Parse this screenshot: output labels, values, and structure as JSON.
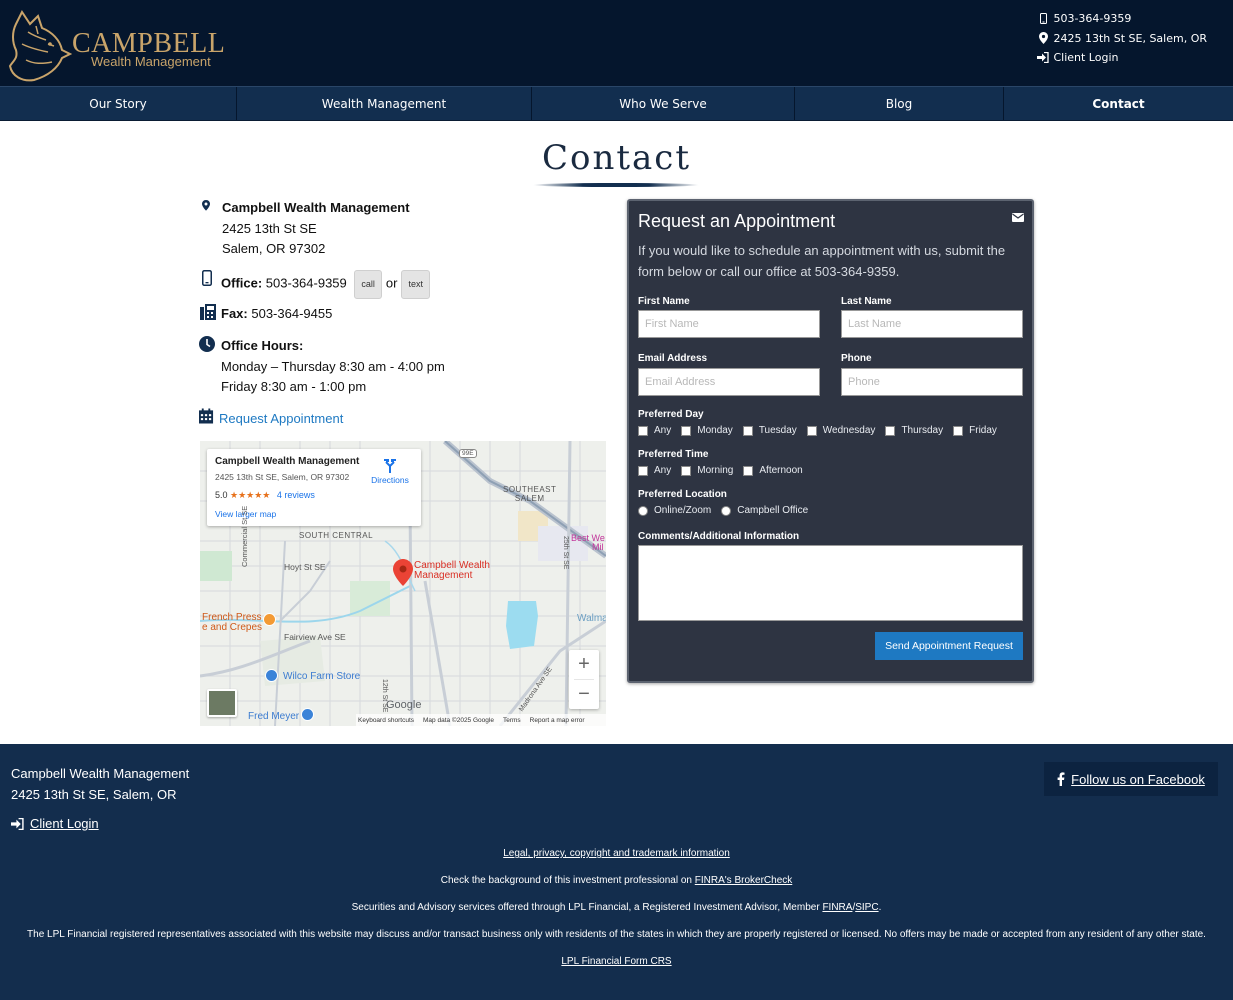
{
  "brand": {
    "name": "CAMPBELL",
    "subtitle": "Wealth Management",
    "logo_icon": "wolf-logo-icon"
  },
  "header": {
    "phone": "503-364-9359",
    "address": "2425 13th St SE, Salem, OR",
    "client_login": "Client Login"
  },
  "nav": {
    "items": [
      {
        "label": "Our Story"
      },
      {
        "label": "Wealth Management"
      },
      {
        "label": "Who We Serve"
      },
      {
        "label": "Blog"
      },
      {
        "label": "Contact",
        "active": true
      }
    ]
  },
  "page": {
    "title": "Contact"
  },
  "info": {
    "company": "Campbell Wealth Management",
    "street": "2425 13th St SE",
    "city": "Salem, OR 97302",
    "office_label": "Office:",
    "office_phone": "503-364-9359",
    "call_label": "call",
    "or_label": "or",
    "text_label": "text",
    "fax_label": "Fax:",
    "fax_number": "503-364-9455",
    "hours_label": "Office Hours:",
    "hours_line1": "Monday – Thursday 8:30 am - 4:00 pm",
    "hours_line2": "Friday 8:30 am - 1:00 pm",
    "request_link": "Request Appointment"
  },
  "map": {
    "card_title": "Campbell Wealth Management",
    "card_address": "2425 13th St SE, Salem, OR 97302",
    "rating": "5.0",
    "stars": "★★★★★",
    "reviews": "4 reviews",
    "larger_map": "View larger map",
    "directions": "Directions",
    "pin_label_1": "Campbell Wealth",
    "pin_label_2": "Management",
    "labels": {
      "southeast_1": "SOUTHEAST",
      "southeast_2": "SALEM",
      "south_central": "SOUTH CENTRAL",
      "hoyt": "Hoyt St SE",
      "commercial": "Commercial St SE",
      "fairview": "Fairview Ave SE",
      "french_1": "French Press",
      "french_2": "e and Crepes",
      "wilco": "Wilco Farm Store",
      "fred": "Fred Meyer",
      "walmart": "Walma",
      "bestwest_1": "Best We",
      "bestwest_2": "Mil",
      "twelfth": "12th St SE",
      "twentyfifth": "25th St SE",
      "madrona": "Madrona Ave SE",
      "highway": "99E",
      "google": "Google"
    },
    "footer_keyboard": "Keyboard shortcuts",
    "footer_data": "Map data ©2025 Google",
    "footer_terms": "Terms",
    "footer_report": "Report a map error"
  },
  "form": {
    "title": "Request an Appointment",
    "intro": "If you would like to schedule an appointment with us, submit the form below or call our office at 503-364-9359.",
    "first_name_label": "First Name",
    "first_name_placeholder": "First Name",
    "last_name_label": "Last Name",
    "last_name_placeholder": "Last Name",
    "email_label": "Email Address",
    "email_placeholder": "Email Address",
    "phone_label": "Phone",
    "phone_placeholder": "Phone",
    "day_label": "Preferred Day",
    "days": [
      "Any",
      "Monday",
      "Tuesday",
      "Wednesday",
      "Thursday",
      "Friday"
    ],
    "time_label": "Preferred Time",
    "times": [
      "Any",
      "Morning",
      "Afternoon"
    ],
    "location_label": "Preferred Location",
    "locations": [
      "Online/Zoom",
      "Campbell Office"
    ],
    "comments_label": "Comments/Additional Information",
    "submit": "Send Appointment Request"
  },
  "footer": {
    "company": "Campbell Wealth Management",
    "address": "2425 13th St SE, Salem, OR",
    "client_login": "Client Login",
    "facebook": "Follow us on Facebook",
    "legal": "Legal, privacy, copyright and trademark information",
    "check_prefix": "Check the background of this investment professional on ",
    "brokercheck": "FINRA's BrokerCheck",
    "securities_prefix": "Securities and Advisory services offered through LPL Financial, a Registered Investment Advisor, Member ",
    "finra": "FINRA",
    "slash": "/",
    "sipc": "SIPC",
    "period": ".",
    "lpl_disclaimer": "The LPL Financial registered representatives associated with this website may discuss and/or transact business only with residents of the states in which they are properly registered or licensed. No offers may be made or accepted from any resident of any other state.",
    "form_crs": "LPL Financial Form CRS"
  },
  "colors": {
    "navy": "#05162d",
    "nav": "#122e4f",
    "gold": "#c9a46a",
    "link": "#1e79c2",
    "form_bg": "#2e3442",
    "footer_bg": "#132d4d"
  }
}
